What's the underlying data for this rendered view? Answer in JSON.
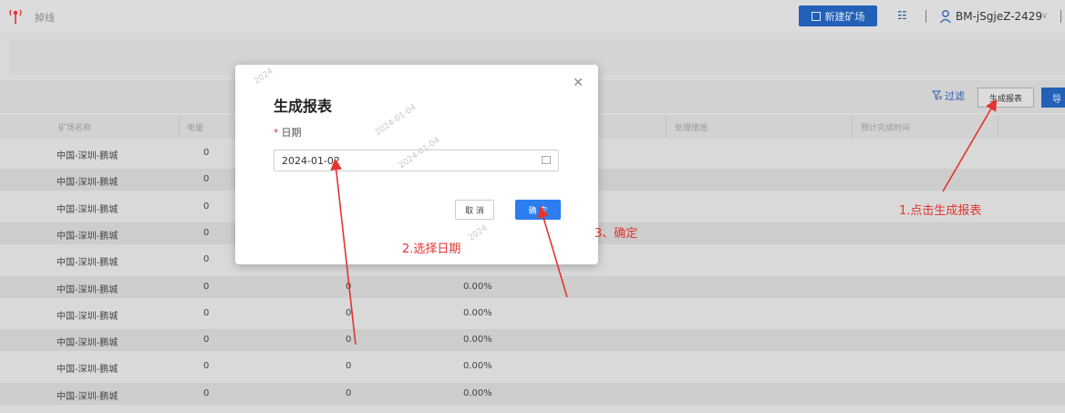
{
  "header": {
    "title": "掉线",
    "new_button_label": "新建矿场",
    "user_name": "BM-jSgjeZ-2429"
  },
  "toolbar": {
    "filter_label": "过滤",
    "report_button_label": "生成报表",
    "export_button_label": "导"
  },
  "table": {
    "columns": [
      "矿场名称",
      "电量",
      "处理措施",
      "预计完成时间"
    ],
    "rows": [
      {
        "name": "中国-深圳-鹏城",
        "c1": "0",
        "c2": "",
        "c3": ""
      },
      {
        "name": "中国-深圳-鹏城",
        "c1": "0",
        "c2": "",
        "c3": ""
      },
      {
        "name": "中国-深圳-鹏城",
        "c1": "0",
        "c2": "",
        "c3": ""
      },
      {
        "name": "中国-深圳-鹏城",
        "c1": "0",
        "c2": "",
        "c3": ""
      },
      {
        "name": "中国-深圳-鹏城",
        "c1": "0",
        "c2": "",
        "c3": ""
      },
      {
        "name": "中国-深圳-鹏城",
        "c1": "0",
        "c2": "0",
        "c3": "0.00%"
      },
      {
        "name": "中国-深圳-鹏城",
        "c1": "0",
        "c2": "0",
        "c3": "0.00%"
      },
      {
        "name": "中国-深圳-鹏城",
        "c1": "0",
        "c2": "0",
        "c3": "0.00%"
      },
      {
        "name": "中国-深圳-鹏城",
        "c1": "0",
        "c2": "0",
        "c3": "0.00%"
      },
      {
        "name": "中国-深圳-鹏城",
        "c1": "0",
        "c2": "0",
        "c3": "0.00%"
      }
    ]
  },
  "modal": {
    "title": "生成报表",
    "field_label": "日期",
    "date_value": "2024-01-02",
    "cancel_label": "取 消",
    "ok_label": "确 定"
  },
  "annotations": {
    "step1": "1.点击生成报表",
    "step2": "2.选择日期",
    "step3": "3、确定"
  },
  "colors": {
    "accent": "#2361b8",
    "primary_button": "#2d7df0",
    "annotation": "#e3342f"
  }
}
